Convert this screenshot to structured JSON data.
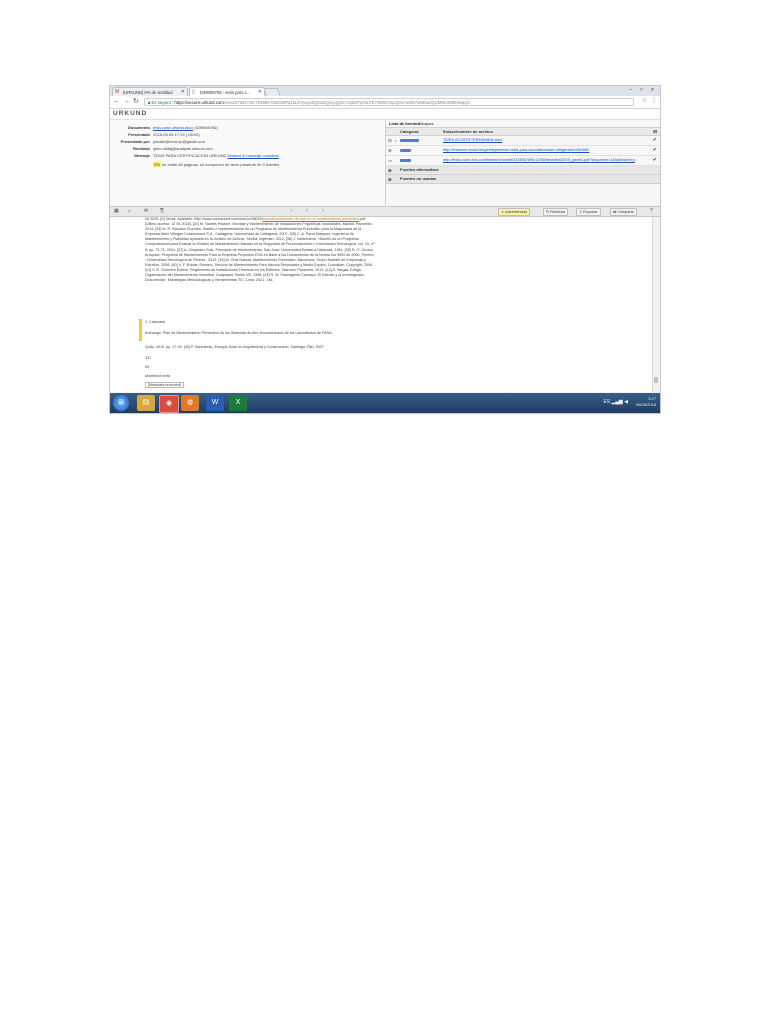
{
  "browser": {
    "tabs": [
      {
        "label": "[URKUND] 0% de similitud",
        "icon": "gmail-icon"
      },
      {
        "label": "D39098765 - tesis para c...",
        "icon": "page-icon"
      }
    ],
    "window_controls": [
      "–",
      "□",
      "✕"
    ],
    "secure_label": "Es seguro",
    "url_host": "https://secure.urkund.com",
    "url_path": "/view/37932735-783894-052039#q1bLKVyaysbQNadQvLjqQ3sYsqksRyOsLTE7NS05YqLQMzAwMrAwMbazQUMDe0MbMwqQA"
  },
  "urkund": {
    "logo": "URKUND",
    "doc_info": [
      {
        "label": "Documento",
        "value": "tesis para urkund.docx",
        "extra": "(D39098765)",
        "is_link": true
      },
      {
        "label": "Presentado",
        "value": "2018-05-06 17:13 (-05:00)",
        "extra": "",
        "is_link": false
      },
      {
        "label": "Presentado por",
        "value": "jravalle@ecocop@gmail.com",
        "extra": "",
        "is_link": false
      },
      {
        "label": "Recibido",
        "value": "ipino.unifaj@analysis.urkund.com",
        "extra": "",
        "is_link": false
      },
      {
        "label": "Mensaje",
        "value": "TESIS PARA CERTIFICACION URKUND",
        "extra": "Mostrar el mensaje completo",
        "is_link": false
      }
    ],
    "summary_percent": "0%",
    "summary_text": "de estas 45 páginas, se componen de texto presente en 0 fuentes."
  },
  "sources": {
    "tabs": [
      "Lista de fuentes",
      "Bloques"
    ],
    "header_category": "Categoría",
    "header_link": "Enlace/nombre de archivo",
    "rows": [
      {
        "url": "TESIS ACOSTA TERMINADA.docx",
        "checked": "✔",
        "bar": 0.45
      },
      {
        "url": "http://erasmus.recaiz.blog/reflejamiento-tesis-para-acondicionador-refrigeracion/52455/",
        "checked": "✔",
        "bar": 0.25
      },
      {
        "url": "http://tesis.ucsm.edu.co/bitstream/handle/1234567890/12365/tesisfinal2019_parte3.pdf?sequence=1&isAllowed=y",
        "checked": "✔",
        "bar": 0.25
      }
    ],
    "alt_sources_label": "Fuentes alternativas",
    "unused_sources_label": "Fuentes no usadas"
  },
  "toolbar": {
    "warnings": "Advertencias",
    "reset": "Reiniciar",
    "export": "Exportar",
    "share": "Compartir"
  },
  "document": {
    "para1": "69 2005. [E] Venta. Available: http://www.solmarzoid.com/read.le/28019/",
    "para1_link": "acondicionamiento-de-aire-en-el-mantenimiento-preventivo",
    "para1_tail": ".pdf [Último acceso: 12 04 2018]. [31] M. Nantes Pastore, Montaje y Mantenimiento de Instalaciones Frigoríficas Industriales, Madrid: Paraninfo, 2014. [34] M. R. Bacaros Guzmán, Diseño e implementación de un Programa de Mantenimiento Preventivo para la Maquinaria de la Empresa Hielo Villegas Construtores S.A., Cartagena: Universidad de Cartagena, 2007. [35] C. A. Parra Márquez, Ingeniería de Mantenimiento y Fiabilidad aplicada en la Gestión de Activos, Sevilla: Ingeman, 2012. [36] J. Valderrama, «Diseño de un Programa Computacional para Evaluar la Gestión de Mantenimiento Basado en la Seguridad de Funcionamiento,» Información Tecnológica, vol. 15, nº 6, pp. 73-72, 2004. [37] A. Cespedes Ruiz, Principios de Mantenimiento, San José: Universidad Estatal a Distancia, 1981. [38] R. O. Orozco Arriquive, Programa de Mantenimiento Para la Empresa Proyectos EOA en Base a los Lineamientos de la Norma Iso 9000 de 2000, Pereira : Universidad Tecnológica de Pereira , 2013. [39] M. Ortiz Nassar, Mantenimiento Preventivo, Barcelona: Grupo Santafé de Empresas y Estudios, 2006. [40] V. F. Roldán Serrano, Servicio de Mantenimiento Para Mezcla Secundaria y Medio Equipo, Cuzcatlan: Copyright, 2006. [41] V. R. Guerrero Esteve, Reglamento de Instalaciones Térmicas en los Edificios, Valencia: Paraninfo, 2013. [42] A. Vargas Zuñiga, Organización del Mantenimiento Industrial, Guayaquil: Series VE, 1998. [43] R. W. Paucagente Cansaco, El Estudio y la Investigación Documental : Estrategias Metodológicas y Herramientas TIC, Lima, 2021, 146.",
    "section": "Y. Calculado",
    "para2": "Archango, Plan de Mantenimiento Preventivo de los Sistemas de Aire Acondicionado de los Laboratorios de FASA.",
    "para3": "Quito, 2010, pp. 27-40. [45] P. Sanmiento, Energía Solar en Arquitectura y Construcción, Santiago: Riel, 2007.",
    "line1": "337",
    "line2": "94",
    "line3": "Montimiot evita",
    "line4": "[Metadata removed]"
  },
  "taskbar": {
    "start": "⊞",
    "apps": [
      {
        "name": "explorer-icon",
        "glyph": "▤",
        "color": "#d6a744"
      },
      {
        "name": "chrome-icon",
        "glyph": "◉",
        "color": "#d94b3d"
      },
      {
        "name": "firefox-icon",
        "glyph": "◍",
        "color": "#e07a28"
      },
      {
        "name": "word-icon",
        "glyph": "W",
        "color": "#2b5fae"
      },
      {
        "name": "excel-icon",
        "glyph": "X",
        "color": "#1f7a3a"
      }
    ],
    "time": "3:27",
    "date": "06/05/2018",
    "lang": "ES"
  }
}
